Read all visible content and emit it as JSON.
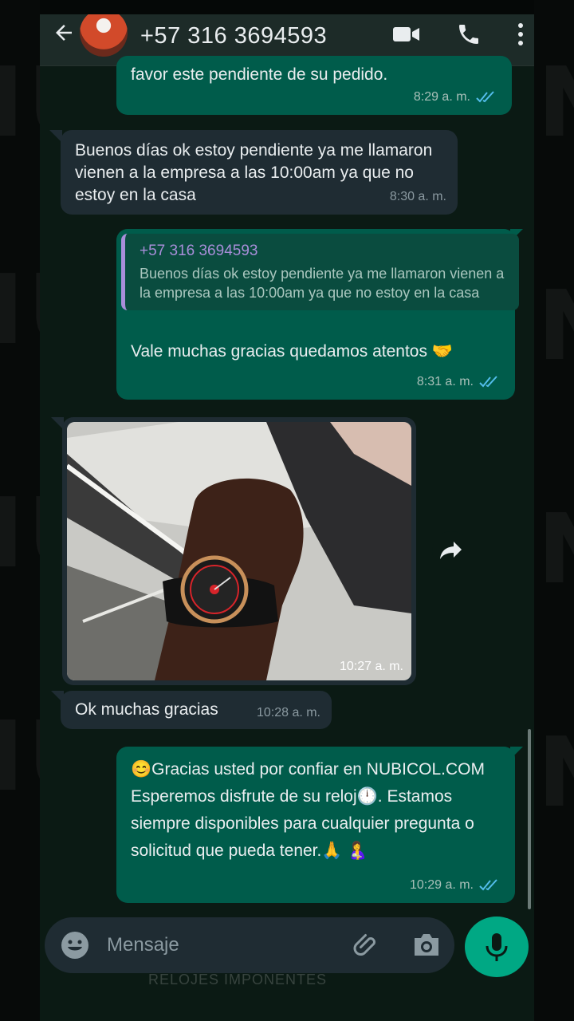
{
  "header": {
    "contact": "+57 316 3694593",
    "icons": [
      "back-arrow-icon",
      "video-call-icon",
      "phone-icon",
      "more-options-icon"
    ]
  },
  "messages": [
    {
      "dir": "out",
      "text": "favor este pendiente de su pedido.",
      "time": "8:29 a. m.",
      "status": "read"
    },
    {
      "dir": "in",
      "text": "Buenos días ok estoy pendiente ya me llamaron vienen a la empresa a las 10:00am ya que no estoy en la casa",
      "time": "8:30 a. m."
    },
    {
      "dir": "out",
      "quote": {
        "name": "+57 316 3694593",
        "text": "Buenos días ok estoy pendiente ya me llamaron vienen a la empresa a las 10:00am ya que no estoy en la casa"
      },
      "text": "Vale muchas gracias quedamos atentos 🤝",
      "time": "8:31 a. m.",
      "status": "read"
    },
    {
      "dir": "in",
      "type": "image",
      "alt": "photo-wristwatch",
      "time": "10:27 a. m."
    },
    {
      "dir": "in",
      "text": "Ok muchas gracias",
      "time": "10:28 a. m."
    },
    {
      "dir": "out",
      "text": "😊Gracias usted por confiar en NUBICOL.COM  Esperemos disfrute de su reloj🕛.  Estamos siempre disponibles para cualquier pregunta o solicitud que pueda tener.🙏 🤱",
      "time": "10:29 a. m.",
      "status": "read"
    }
  ],
  "input": {
    "placeholder": "Mensaje"
  },
  "watermark": {
    "brand": "NUBI",
    "tagline": "RELOJES IMPONENTES"
  },
  "colors": {
    "outgoing": "#005c4b",
    "incoming": "#1f2c33",
    "accent": "#00a884",
    "quote_name": "#a98eda"
  }
}
